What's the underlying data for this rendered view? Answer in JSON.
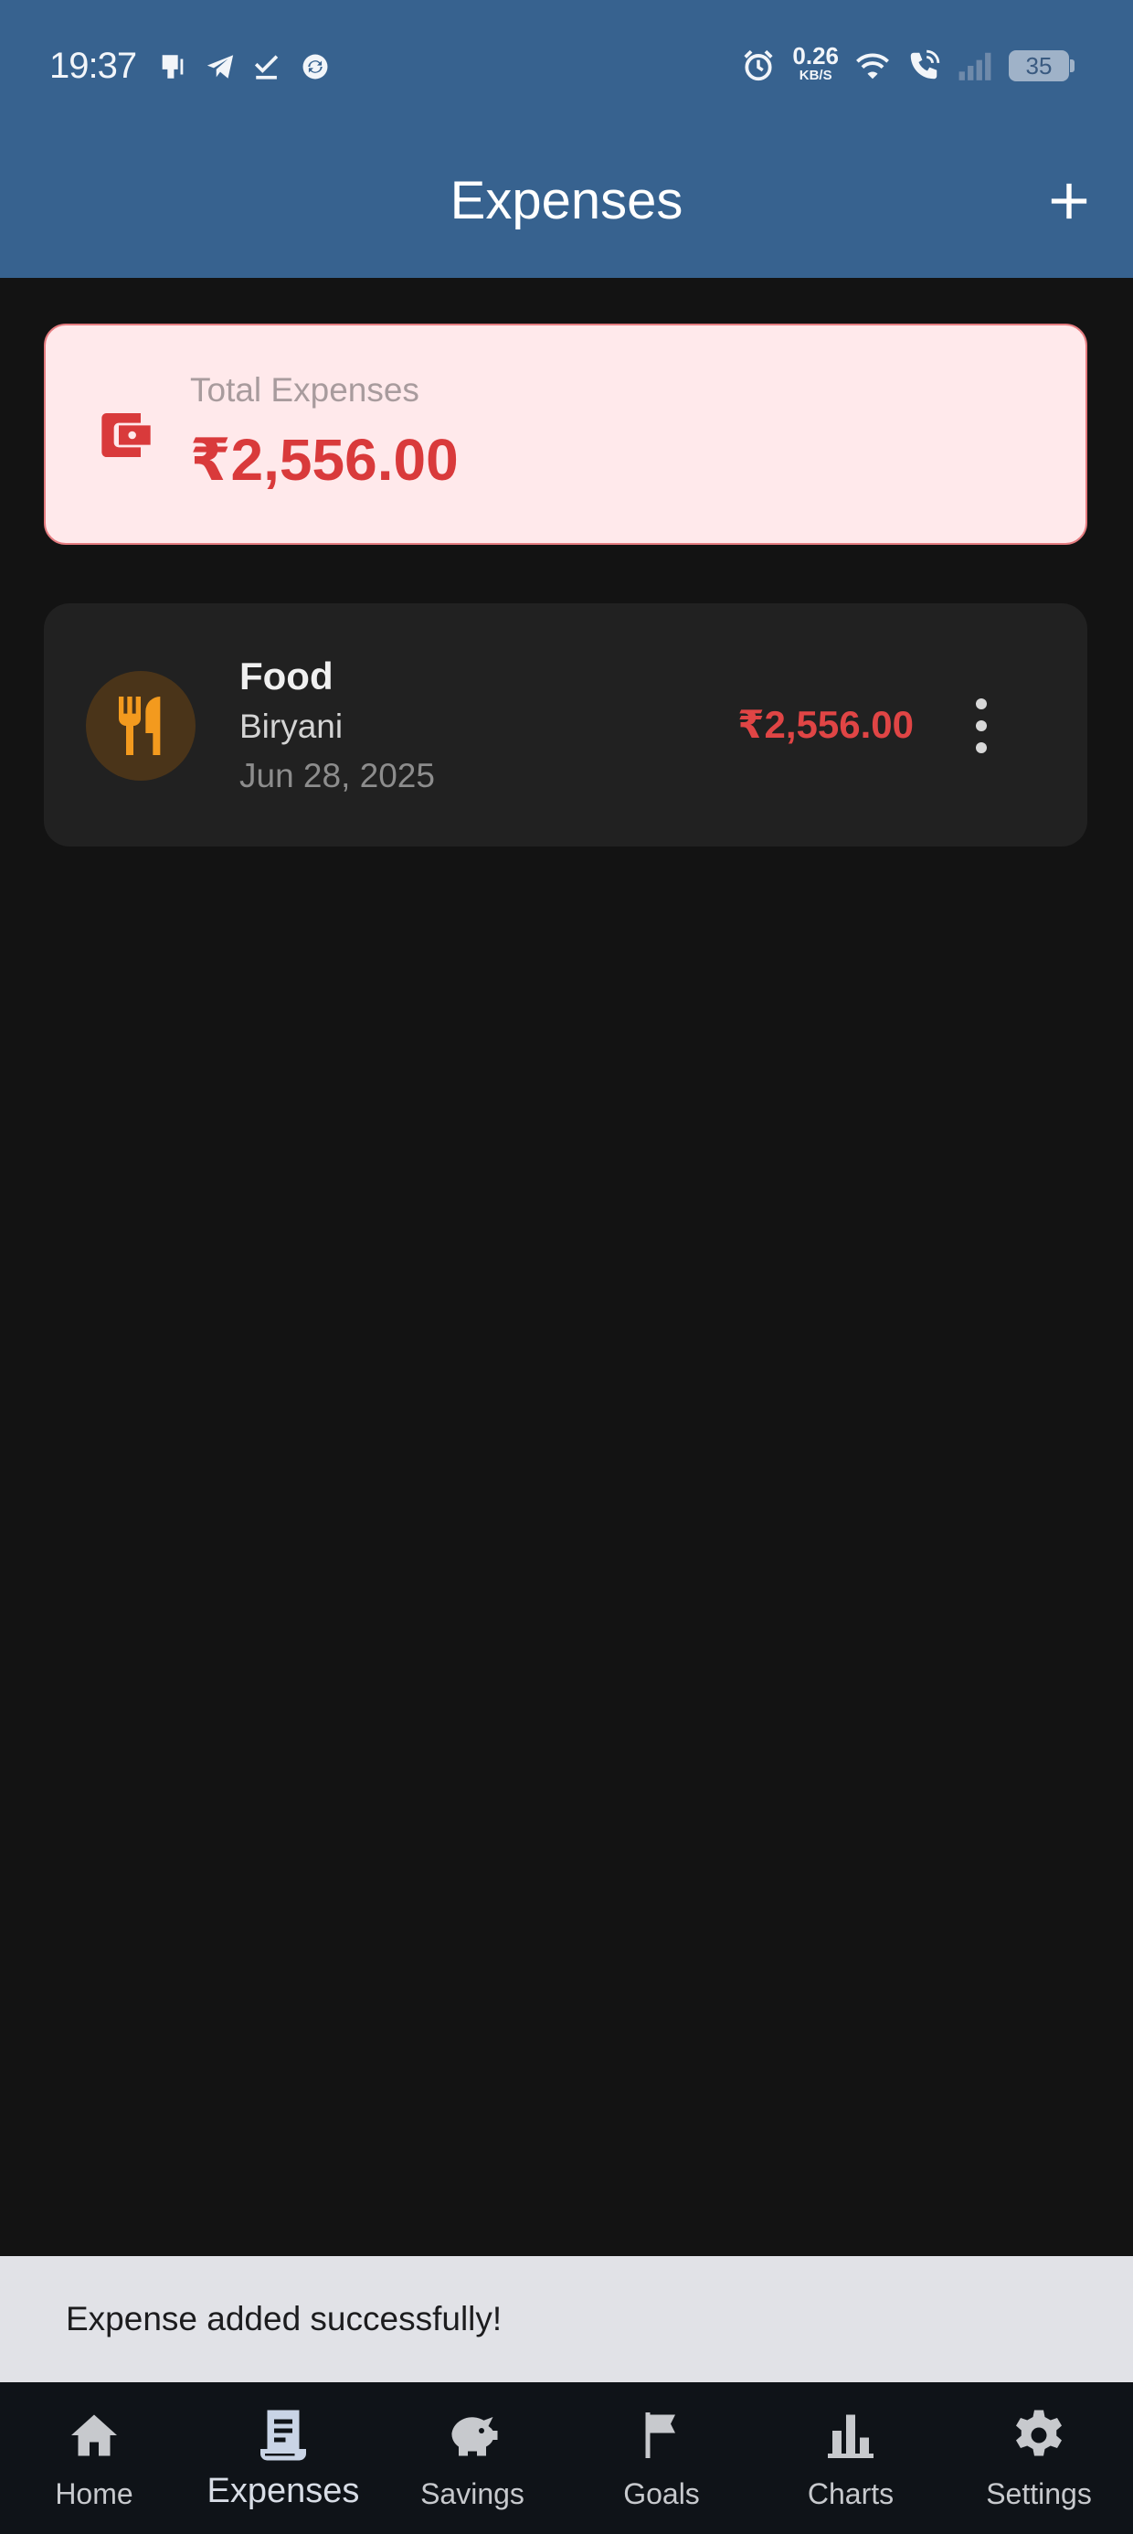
{
  "status_bar": {
    "time": "19:37",
    "net_speed_value": "0.26",
    "net_speed_unit": "KB/S",
    "battery": "35",
    "left_icons": [
      "notification-icon",
      "telegram-icon",
      "check-icon",
      "sync-icon"
    ],
    "right_icons": [
      "alarm-icon",
      "wifi-icon",
      "wifi-call-icon",
      "signal-icon",
      "battery-icon"
    ]
  },
  "header": {
    "title": "Expenses",
    "add_icon": "plus-icon",
    "background": "#37628f"
  },
  "summary": {
    "label": "Total Expenses",
    "value": "₹2,556.00",
    "icon": "wallet-icon",
    "accent": "#d93a3b"
  },
  "expenses": [
    {
      "category": "Food",
      "description": "Biryani",
      "date": "Jun 28, 2025",
      "amount": "₹2,556.00",
      "icon": "restaurant-icon",
      "icon_color": "#f39a1e"
    }
  ],
  "snackbar": {
    "message": "Expense added successfully!"
  },
  "nav": {
    "active": "Expenses",
    "items": [
      {
        "label": "Home",
        "icon": "home-icon"
      },
      {
        "label": "Expenses",
        "icon": "receipt-icon"
      },
      {
        "label": "Savings",
        "icon": "piggy-bank-icon"
      },
      {
        "label": "Goals",
        "icon": "flag-icon"
      },
      {
        "label": "Charts",
        "icon": "bar-chart-icon"
      },
      {
        "label": "Settings",
        "icon": "gear-icon"
      }
    ]
  }
}
